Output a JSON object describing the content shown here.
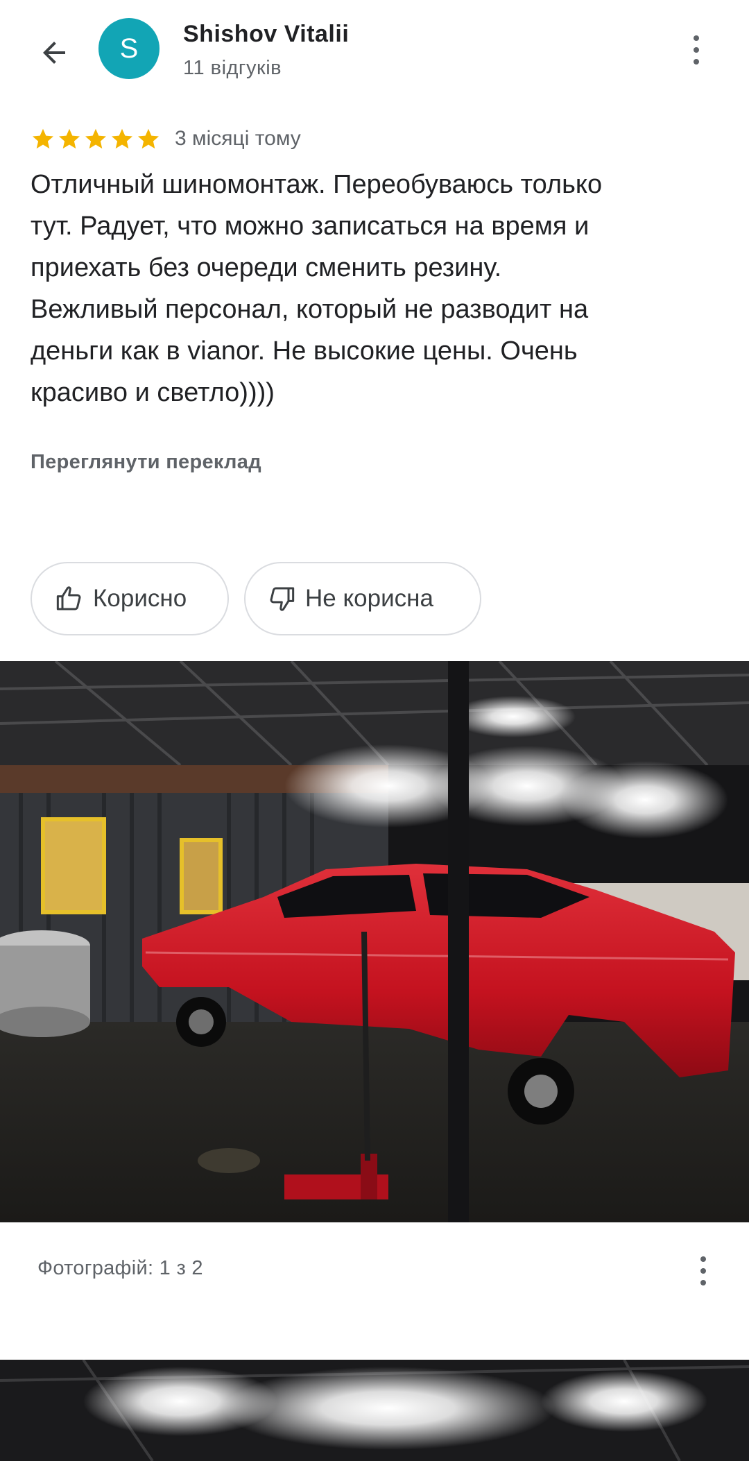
{
  "header": {
    "avatar_letter": "S",
    "user_name": "Shishov Vitalii",
    "reviews_count": "11 відгуків"
  },
  "review": {
    "rating": 5,
    "max_rating": 5,
    "date": "3 місяці тому",
    "text": "Отличный шиномонтаж. Переобуваюсь только\nтут. Радует, что можно записаться на время и\nприехать без очереди сменить резину.\nВежливый персонал, который не разводит на\nденьги как в vianor. Не высокие цены. Очень\nкрасиво и светло))))",
    "translate_label": "Переглянути переклад"
  },
  "votes": {
    "helpful_label": "Корисно",
    "not_helpful_label": "Не корисна"
  },
  "photos": {
    "caption": "Фотографій: 1 з 2"
  },
  "colors": {
    "avatar_bg": "#12a5b5",
    "star": "#f4b400",
    "car": "#c8102e"
  },
  "icons": [
    "back-arrow-icon",
    "more-vert-icon",
    "star-icon",
    "thumbs-up-icon",
    "thumbs-down-icon"
  ]
}
